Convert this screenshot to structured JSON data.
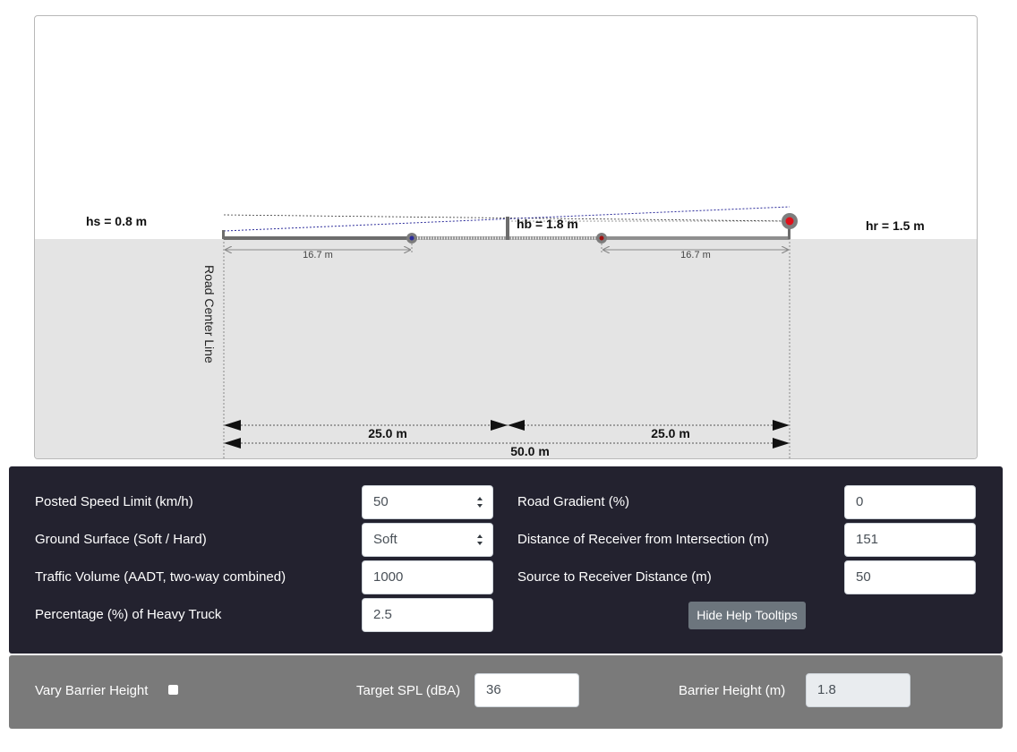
{
  "diagram": {
    "hs_label": "hs = 0.8 m",
    "hb_label": "hb = 1.8 m",
    "hr_label": "hr = 1.5 m",
    "road_center_label": "Road Center Line",
    "left_lane_dim": "16.7 m",
    "right_lane_dim": "16.7 m",
    "left_half_dim": "25.0 m",
    "right_half_dim": "25.0 m",
    "total_dim": "50.0 m",
    "colors": {
      "ground": "#e4e4e4",
      "road": "#6d6d6d",
      "sight_line": "#2b2b9a",
      "receiver": "#e0101a"
    }
  },
  "inputs": {
    "speed_label": "Posted Speed Limit (km/h)",
    "speed_value": "50",
    "ground_label": "Ground Surface (Soft / Hard)",
    "ground_value": "Soft",
    "traffic_label": "Traffic Volume (AADT, two-way combined)",
    "traffic_value": "1000",
    "truck_label": "Percentage (%) of Heavy Truck",
    "truck_value": "2.5",
    "gradient_label": "Road Gradient (%)",
    "gradient_value": "0",
    "intersection_label": "Distance of Receiver from Intersection (m)",
    "intersection_value": "151",
    "s2r_label": "Source to Receiver Distance (m)",
    "s2r_value": "50",
    "help_button": "Hide Help Tooltips"
  },
  "barrier": {
    "vary_label": "Vary Barrier Height",
    "vary_checked": false,
    "target_label": "Target SPL (dBA)",
    "target_value": "36",
    "height_label": "Barrier Height (m)",
    "height_value": "1.8"
  }
}
